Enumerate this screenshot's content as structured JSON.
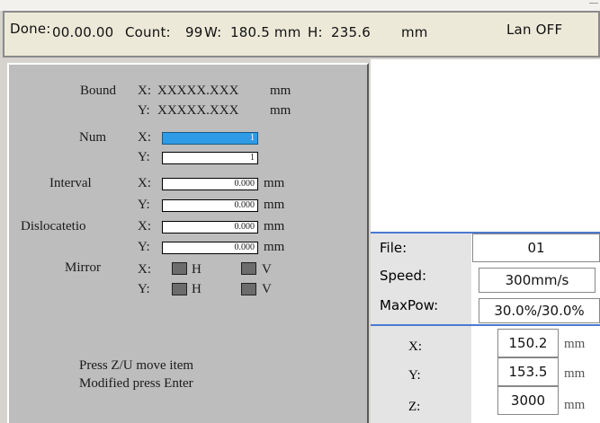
{
  "status": {
    "done_label": "Done:",
    "done_value": "00.00.00",
    "count_label": "Count:",
    "count_value": "99",
    "w_label": "W:",
    "w_value": "180.5 mm",
    "h_label": "H:",
    "h_value": "235.6",
    "unit": "mm",
    "lan": "Lan OFF"
  },
  "array_panel": {
    "bound": {
      "label": "Bound",
      "x_axis": "X:",
      "x_value": "XXXXX.XXX",
      "x_unit": "mm",
      "y_axis": "Y:",
      "y_value": "XXXXX.XXX",
      "y_unit": "mm"
    },
    "num": {
      "label": "Num",
      "x_axis": "X:",
      "x_value": "1",
      "y_axis": "Y:",
      "y_value": "1"
    },
    "interval": {
      "label": "Interval",
      "x_axis": "X:",
      "x_value": "0.000",
      "x_unit": "mm",
      "y_axis": "Y:",
      "y_value": "0.000",
      "y_unit": "mm"
    },
    "dislocation": {
      "label": "Dislocatetio",
      "x_axis": "X:",
      "x_value": "0.000",
      "x_unit": "mm",
      "y_axis": "Y:",
      "y_value": "0.000",
      "y_unit": "mm"
    },
    "mirror": {
      "label": "Mirror",
      "x_axis": "X:",
      "y_axis": "Y:",
      "h_label": "H",
      "v_label": "V"
    },
    "hint_line1": "Press Z/U move item",
    "hint_line2": "Modified press Enter"
  },
  "info": {
    "file_label": "File:",
    "file_value": "01",
    "speed_label": "Speed:",
    "speed_value": "300mm/s",
    "maxpow_label": "MaxPow:",
    "maxpow_value": "30.0%/30.0%",
    "x_label": "X:",
    "x_value": "150.2",
    "x_unit": "mm",
    "y_label": "Y:",
    "y_value": "153.5",
    "y_unit": "mm",
    "z_label": "Z:",
    "z_value": "3000",
    "z_unit": "mm"
  },
  "colors": {
    "selected_field": "#2f9be6",
    "panel_bg": "#bdbdbd",
    "separator": "#4a7ad0"
  }
}
